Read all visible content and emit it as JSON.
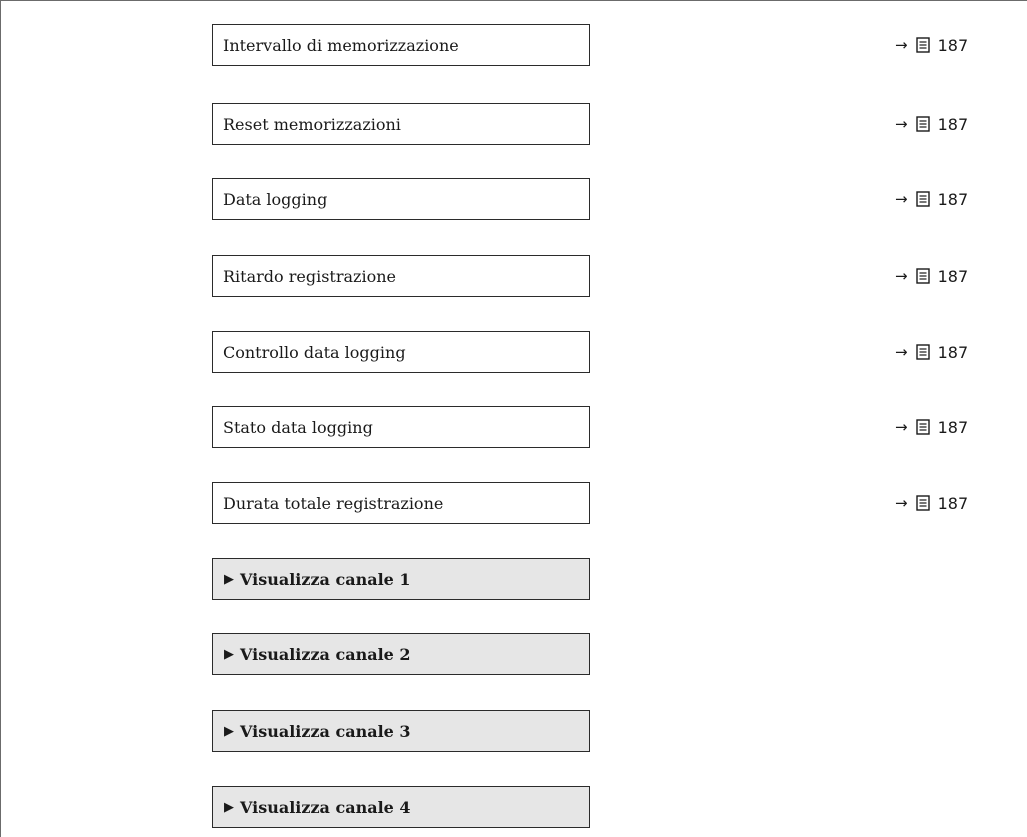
{
  "parameters": [
    {
      "label": "Intervallo di memorizzazione",
      "arrow": "→",
      "page": "187"
    },
    {
      "label": "Reset memorizzazioni",
      "arrow": "→",
      "page": "187"
    },
    {
      "label": "Data logging",
      "arrow": "→",
      "page": "187"
    },
    {
      "label": "Ritardo registrazione",
      "arrow": "→",
      "page": "187"
    },
    {
      "label": "Controllo data logging",
      "arrow": "→",
      "page": "187"
    },
    {
      "label": "Stato data logging",
      "arrow": "→",
      "page": "187"
    },
    {
      "label": "Durata totale registrazione",
      "arrow": "→",
      "page": "187"
    }
  ],
  "submenus": [
    {
      "marker": "▶",
      "label": "Visualizza canale 1"
    },
    {
      "marker": "▶",
      "label": "Visualizza canale 2"
    },
    {
      "marker": "▶",
      "label": "Visualizza canale 3"
    },
    {
      "marker": "▶",
      "label": "Visualizza canale 4"
    }
  ],
  "icons": {
    "page_reference": "book-page-icon"
  }
}
